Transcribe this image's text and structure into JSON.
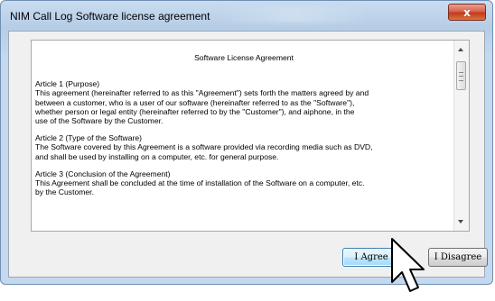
{
  "window": {
    "title": "NIM Call Log Software license agreement",
    "close_glyph": "x"
  },
  "agreement": {
    "heading": "Software License Agreement",
    "articles": [
      {
        "text": "Article 1 (Purpose)\n This agreement (hereinafter referred to as this \"Agreement\") sets forth the matters agreed by and\nbetween a customer, who is a user of our software (hereinafter referred to as the \"Software\"),\nwhether person or legal entity (hereinafter referred to by the \"Customer\"), and aiphone, in the\n use of the Software by the Customer."
      },
      {
        "text": "Article 2 (Type of the Software)\n The Software covered by this Agreement is a software provided via recording media such as DVD,\nand shall be used by installing on a computer, etc. for general purpose."
      },
      {
        "text": "Article 3 (Conclusion of the Agreement)\nThis Agreement shall be concluded at the time of installation of the Software on a computer, etc.\nby the Customer."
      }
    ]
  },
  "buttons": {
    "agree": "I Agree",
    "disagree": "I Disagree"
  },
  "icons": {
    "close": "close-icon",
    "scroll_up": "chevron-up-icon",
    "scroll_down": "chevron-down-icon",
    "cursor": "mouse-pointer-icon"
  },
  "colors": {
    "close_button": "#c3391f",
    "agree_button_border": "#3c7fb1",
    "titlebar": "#b6cde6"
  }
}
